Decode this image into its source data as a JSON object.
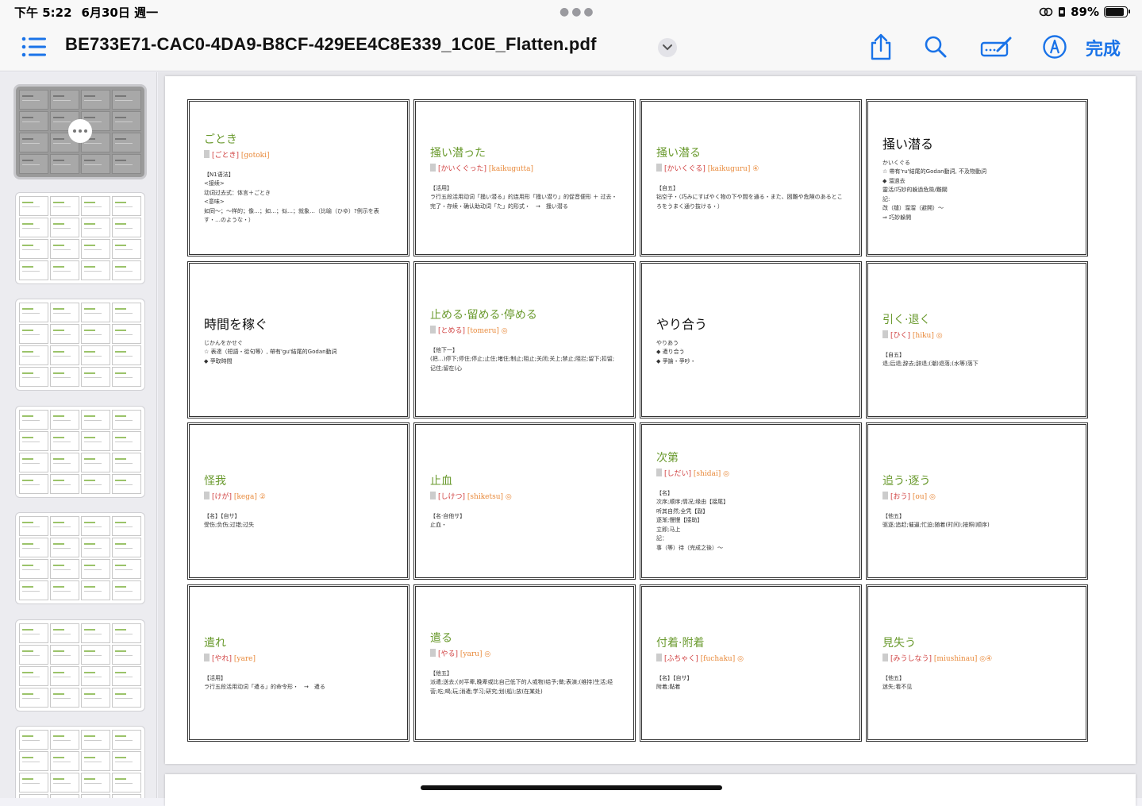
{
  "status": {
    "time": "下午 5:22",
    "date": "6月30日 週一",
    "battery_pct": "89%",
    "battery_level": 0.89
  },
  "toolbar": {
    "title": "BE733E71-CAC0-4DA9-B8CF-429EE4C8E339_1C0E_Flatten.pdf",
    "done_label": "完成",
    "accent": "#1a73e8"
  },
  "cards": [
    {
      "word": "ごとき",
      "kana": "[ごとき]",
      "romaji": "[gotoki]",
      "body": "【N1语法】\n<接续>\n动词过去式：体言＋ごとき\n<意味>\n如同～；～样的；像…；如…；似…；就象…（比喻（ひゆ）?例示を表す・…のような・）"
    },
    {
      "word": "掻い潜った",
      "kana": "[かいくぐった]",
      "romaji": "[kaikugutta]",
      "body": "【活用】\nラ行五段活用动词「掻い潜る」的连用形「掻い潜り」的促音便形 ＋ 过去・完了・存续・确认助动词「た」的形式・　→　掻い潜る"
    },
    {
      "word": "掻い潜る",
      "kana": "[かいくぐる]",
      "romaji": "[kaikuguru] ④",
      "body": "【自五】\n钻空子・（巧みにすばやく物の下や間を通る・また、困難や危険のあるところをうまく通り抜ける・）"
    },
    {
      "word": "掻い潜る",
      "kana": "",
      "romaji": "",
      "black": true,
      "body": "かいくぐる\n☆ 帶有'ru'結尾的Godan動詞, 不及物動詞\n◆ 溜過去\n靈活/巧妙的躲過危險/難關\n記:\n改（缝）溜溜（避開）～\n⇒ 巧妙躲開"
    },
    {
      "word": "時間を稼ぐ",
      "kana": "",
      "romaji": "",
      "black": true,
      "body": "じかんをかせぐ\n☆ 表達（短語・從句等）, 帶有'gu'結尾的Godan動詞\n◆ 爭取時間"
    },
    {
      "word": "止める·留める·停める",
      "kana": "[とめる]",
      "romaji": "[tomeru] ◎",
      "body": "【他下一】\n(把…)停下;停住;停止;止住;堵住;制止;阻止;关闭;关上;禁止;阻拦;留下;扣留;记住;留在(心"
    },
    {
      "word": "やり合う",
      "kana": "",
      "romaji": "",
      "black": true,
      "body": "やりあう\n◆ 遣り合う\n◆ 爭論・爭吵・"
    },
    {
      "word": "引く·退く",
      "kana": "[ひく]",
      "romaji": "[hiku] ◎",
      "body": "【自五】\n退;后退;辞去;辞退;(潮)退落;(水等)落下"
    },
    {
      "word": "怪我",
      "kana": "[けが]",
      "romaji": "[kega] ②",
      "body": "【名】【自サ】\n受伤;负伤;过错;过失"
    },
    {
      "word": "止血",
      "kana": "[しけつ]",
      "romaji": "[shiketsu] ◎",
      "body": "【名·自他サ】\n止血・"
    },
    {
      "word": "次第",
      "kana": "[しだい]",
      "romaji": "[shidai] ◎",
      "body": "【名】\n次序;顺序;情况;缘由【接尾】\n听其自然;全凭【副】\n逐渐;慢慢【接助】\n立即;马上\n記：\n事（等）待（完成之後）～"
    },
    {
      "word": "追う·逐う",
      "kana": "[おう]",
      "romaji": "[ou] ◎",
      "body": "【他五】\n驱逐;追赶;催逼;忙迫;随着(时间);按照(顺序)"
    },
    {
      "word": "遣れ",
      "kana": "[やれ]",
      "romaji": "[yare]",
      "body": "【活用】\nラ行五段活用动词「遣る」的命令形・　→　遣る"
    },
    {
      "word": "遣る",
      "kana": "[やる]",
      "romaji": "[yaru] ◎",
      "body": "【他五】\n派遣;送去;(对平辈,晚辈或比自己低下的人或物)给予;做;表演;(维持)生活;经营;吃;喝;玩;消遣;学习;研究;划(船);放(在某处)"
    },
    {
      "word": "付着·附着",
      "kana": "[ふちゃく]",
      "romaji": "[fuchaku] ◎",
      "body": "【名】【自サ】\n附着;黏着"
    },
    {
      "word": "見失う",
      "kana": "[みうしなう]",
      "romaji": "[miushinau] ◎④",
      "body": "【他五】\n迷失;看不见"
    }
  ]
}
